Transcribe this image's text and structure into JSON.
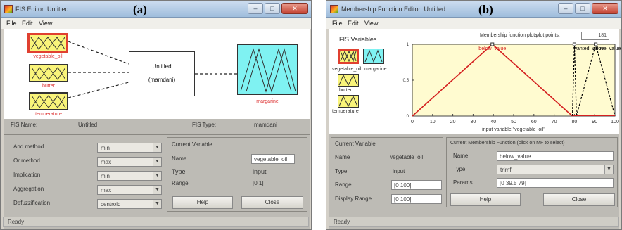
{
  "window_a": {
    "title": "FIS Editor: Untitled",
    "panel_label": "(a)",
    "menu": [
      "File",
      "Edit",
      "View"
    ],
    "title_buttons": [
      "–",
      "□",
      "✕"
    ],
    "inputs": [
      "vegetable_oil",
      "butter",
      "temperature"
    ],
    "system_block": {
      "name": "Untitled",
      "type_label": "(mamdani)"
    },
    "output": "margarine",
    "fis_name_label": "FIS Name:",
    "fis_name_value": "Untitled",
    "fis_type_label": "FIS Type:",
    "fis_type_value": "mamdani",
    "methods": [
      {
        "label": "And method",
        "value": "min"
      },
      {
        "label": "Or method",
        "value": "max"
      },
      {
        "label": "Implication",
        "value": "min"
      },
      {
        "label": "Aggregation",
        "value": "max"
      },
      {
        "label": "Defuzzification",
        "value": "centroid"
      }
    ],
    "current_variable": {
      "header": "Current Variable",
      "name_label": "Name",
      "name_value": "vegetable_oil",
      "type_label": "Type",
      "type_value": "input",
      "range_label": "Range",
      "range_value": "[0 1]"
    },
    "help_button": "Help",
    "close_button": "Close",
    "status": "Ready"
  },
  "window_b": {
    "title": "Membership Function Editor: Untitled",
    "panel_label": "(b)",
    "menu": [
      "File",
      "Edit",
      "View"
    ],
    "title_buttons": [
      "–",
      "□",
      "✕"
    ],
    "fis_variables_label": "FIS Variables",
    "variables": [
      "vegetable_oil",
      "margarine",
      "butter",
      "temperature"
    ],
    "plot_header": "Membership function plots",
    "plot_points_label": "plot points:",
    "plot_points_value": "181",
    "xlabel": "input variable \"vegetable_oil\"",
    "mf_labels": [
      "below_value",
      "wanted_value",
      "above_value"
    ],
    "current_variable": {
      "header": "Current Variable",
      "name_label": "Name",
      "name_value": "vegetable_oil",
      "type_label": "Type",
      "type_value": "input",
      "range_label": "Range",
      "range_value": "[0 100]",
      "display_range_label": "Display Range",
      "display_range_value": "[0 100]"
    },
    "current_mf": {
      "header": "Current Membership Function (click on MF to select)",
      "name_label": "Name",
      "name_value": "below_value",
      "type_label": "Type",
      "type_value": "trimf",
      "params_label": "Params",
      "params_value": "[0 39.5 79]"
    },
    "help_button": "Help",
    "close_button": "Close",
    "status": "Ready"
  },
  "chart_data": {
    "type": "line",
    "xlabel": "input variable \"vegetable_oil\"",
    "xlim": [
      0,
      100
    ],
    "ylim": [
      0,
      1
    ],
    "x_ticks": [
      0,
      10,
      20,
      30,
      40,
      50,
      60,
      70,
      80,
      90,
      100
    ],
    "y_ticks": [
      0,
      0.5,
      1
    ],
    "series": [
      {
        "name": "below_value",
        "x": [
          0,
          39.5,
          79
        ],
        "y": [
          0,
          1,
          0
        ],
        "color": "#d42020"
      },
      {
        "name": "wanted_value",
        "x": [
          79,
          80,
          81
        ],
        "y": [
          0,
          1,
          0
        ],
        "color": "#000000"
      },
      {
        "name": "above_value",
        "x": [
          81,
          90.5,
          100
        ],
        "y": [
          0,
          1,
          0
        ],
        "color": "#000000"
      }
    ]
  }
}
